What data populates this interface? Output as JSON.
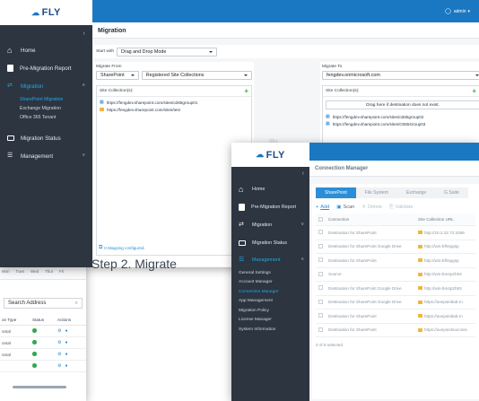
{
  "migration_window": {
    "logo_text": "FLY",
    "user": "admin",
    "page_title": "Migration",
    "sidebar": {
      "items": [
        {
          "label": "Home"
        },
        {
          "label": "Pre-Migration Report"
        },
        {
          "label": "Migration",
          "subitems": [
            "SharePoint Migration",
            "Exchange Migration",
            "Office 365 Tenant"
          ]
        },
        {
          "label": "Migration Status"
        },
        {
          "label": "Management"
        }
      ]
    },
    "start_with_label": "Start with",
    "start_with_value": "Drag and Drop Mode",
    "migrate_from_label": "Migrate From",
    "source_platform": "SharePoint",
    "source_scope": "Registered Site Collections",
    "site_collections_label": "Site Collection(s):",
    "source_sites": [
      "https://fengdev.sharepoint.com/sites/o365group01",
      "https://fengdev.sharepoint.com/sites/test"
    ],
    "migrate_to_label": "Migrate To",
    "dest_tenant": "fengdev.onmicrosoft.com",
    "dest_site_collections_label": "Site Collection(s):",
    "drag_hint": "Drag here if destination does not exist.",
    "dest_sites": [
      "https://fengdev.sharepoint.com/sites/o365group02",
      "https://fengdev.sharepoint.com/sites/O365Group03"
    ],
    "mapping_text": "0 Mapping configured."
  },
  "step_label": "Step 2. Migrate",
  "left_window": {
    "days": [
      "Mon",
      "Tues",
      "Wed",
      "Thur",
      "Fri"
    ],
    "search_placeholder": "Search Address",
    "columns": [
      "on Type",
      "Status",
      "Actions"
    ],
    "rows": [
      "ontal",
      "ontal",
      "ontal",
      ""
    ]
  },
  "connection_window": {
    "logo_text": "FLY",
    "page_title": "Connection Manager",
    "sidebar": {
      "items": [
        {
          "label": "Home"
        },
        {
          "label": "Pre-Migration Report"
        },
        {
          "label": "Migration"
        },
        {
          "label": "Migration Status"
        },
        {
          "label": "Management"
        }
      ],
      "management_subitems": [
        "General Settings",
        "Account Manager",
        "Connection Manager",
        "App Management",
        "Migration Policy",
        "License Manager",
        "System Information"
      ]
    },
    "tabs": [
      "SharePoint",
      "File System",
      "Exchange",
      "G Suite"
    ],
    "toolbar": {
      "add": "Add",
      "scan": "Scan",
      "delete": "Delete",
      "validate": "Validate"
    },
    "columns": [
      "Connection",
      "Site Collection URL"
    ],
    "rows": [
      {
        "name": "Destination for SharePoint",
        "url": "http://10.2.22.72:2059"
      },
      {
        "name": "Destination for SharePoint Google Drive",
        "url": "http://win-bfhspgsp"
      },
      {
        "name": "Destination for SharePoint",
        "url": "http://win-bfhspgsp"
      },
      {
        "name": "Source",
        "url": "http://win-bm4p2h93"
      },
      {
        "name": "Destination for SharePoint Google Drive",
        "url": "http://win-bm4p2h93"
      },
      {
        "name": "Destination for SharePoint Google Drive",
        "url": "https://avepointlab-m"
      },
      {
        "name": "Destination for SharePoint",
        "url": "https://avepointlab-m"
      },
      {
        "name": "Destination for SharePoint",
        "url": "https://avepointsuccess"
      }
    ],
    "selected_text": "0 of 8 selected"
  }
}
